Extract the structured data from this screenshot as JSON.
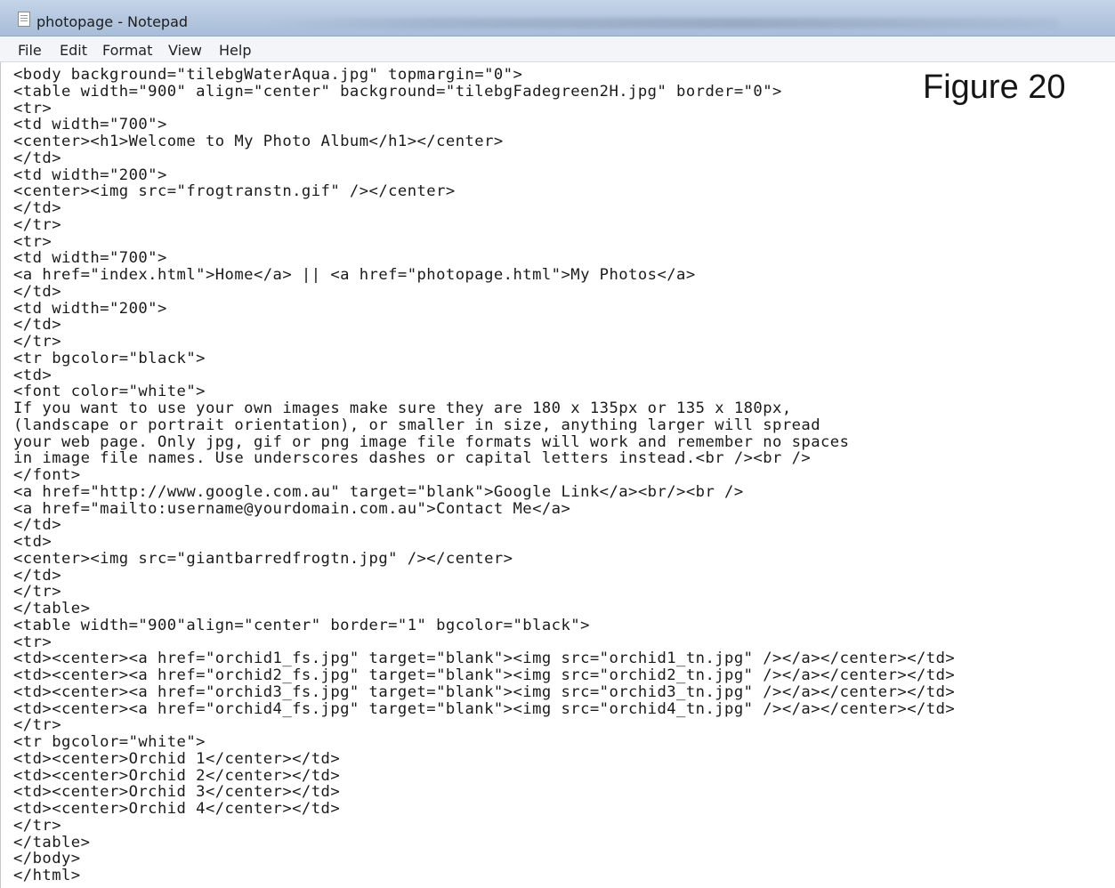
{
  "window": {
    "title": "photopage - Notepad",
    "icon": "notepad-icon"
  },
  "menu": [
    "File",
    "Edit",
    "Format",
    "View",
    "Help"
  ],
  "figure_label": "Figure 20",
  "code_lines": [
    "<body background=\"tilebgWaterAqua.jpg\" topmargin=\"0\">",
    "<table width=\"900\" align=\"center\" background=\"tilebgFadegreen2H.jpg\" border=\"0\">",
    "<tr>",
    "<td width=\"700\">",
    "<center><h1>Welcome to My Photo Album</h1></center>",
    "</td>",
    "<td width=\"200\">",
    "<center><img src=\"frogtranstn.gif\" /></center>",
    "</td>",
    "</tr>",
    "<tr>",
    "<td width=\"700\">",
    "<a href=\"index.html\">Home</a> || <a href=\"photopage.html\">My Photos</a>",
    "</td>",
    "<td width=\"200\">",
    "</td>",
    "</tr>",
    "<tr bgcolor=\"black\">",
    "<td>",
    "<font color=\"white\">",
    "If you want to use your own images make sure they are 180 x 135px or 135 x 180px,",
    "(landscape or portrait orientation), or smaller in size, anything larger will spread",
    "your web page. Only jpg, gif or png image file formats will work and remember no spaces",
    "in image file names. Use underscores dashes or capital letters instead.<br /><br />",
    "</font>",
    "<a href=\"http://www.google.com.au\" target=\"blank\">Google Link</a><br/><br />",
    "<a href=\"mailto:username@yourdomain.com.au\">Contact Me</a>",
    "</td>",
    "<td>",
    "<center><img src=\"giantbarredfrogtn.jpg\" /></center>",
    "</td>",
    "</tr>",
    "</table>",
    "<table width=\"900\"align=\"center\" border=\"1\" bgcolor=\"black\">",
    "<tr>",
    "<td><center><a href=\"orchid1_fs.jpg\" target=\"blank\"><img src=\"orchid1_tn.jpg\" /></a></center></td>",
    "<td><center><a href=\"orchid2_fs.jpg\" target=\"blank\"><img src=\"orchid2_tn.jpg\" /></a></center></td>",
    "<td><center><a href=\"orchid3_fs.jpg\" target=\"blank\"><img src=\"orchid3_tn.jpg\" /></a></center></td>",
    "<td><center><a href=\"orchid4_fs.jpg\" target=\"blank\"><img src=\"orchid4_tn.jpg\" /></a></center></td>",
    "</tr>",
    "<tr bgcolor=\"white\">",
    "<td><center>Orchid 1</center></td>",
    "<td><center>Orchid 2</center></td>",
    "<td><center>Orchid 3</center></td>",
    "<td><center>Orchid 4</center></td>",
    "</tr>",
    "</table>",
    "</body>",
    "</html>"
  ]
}
